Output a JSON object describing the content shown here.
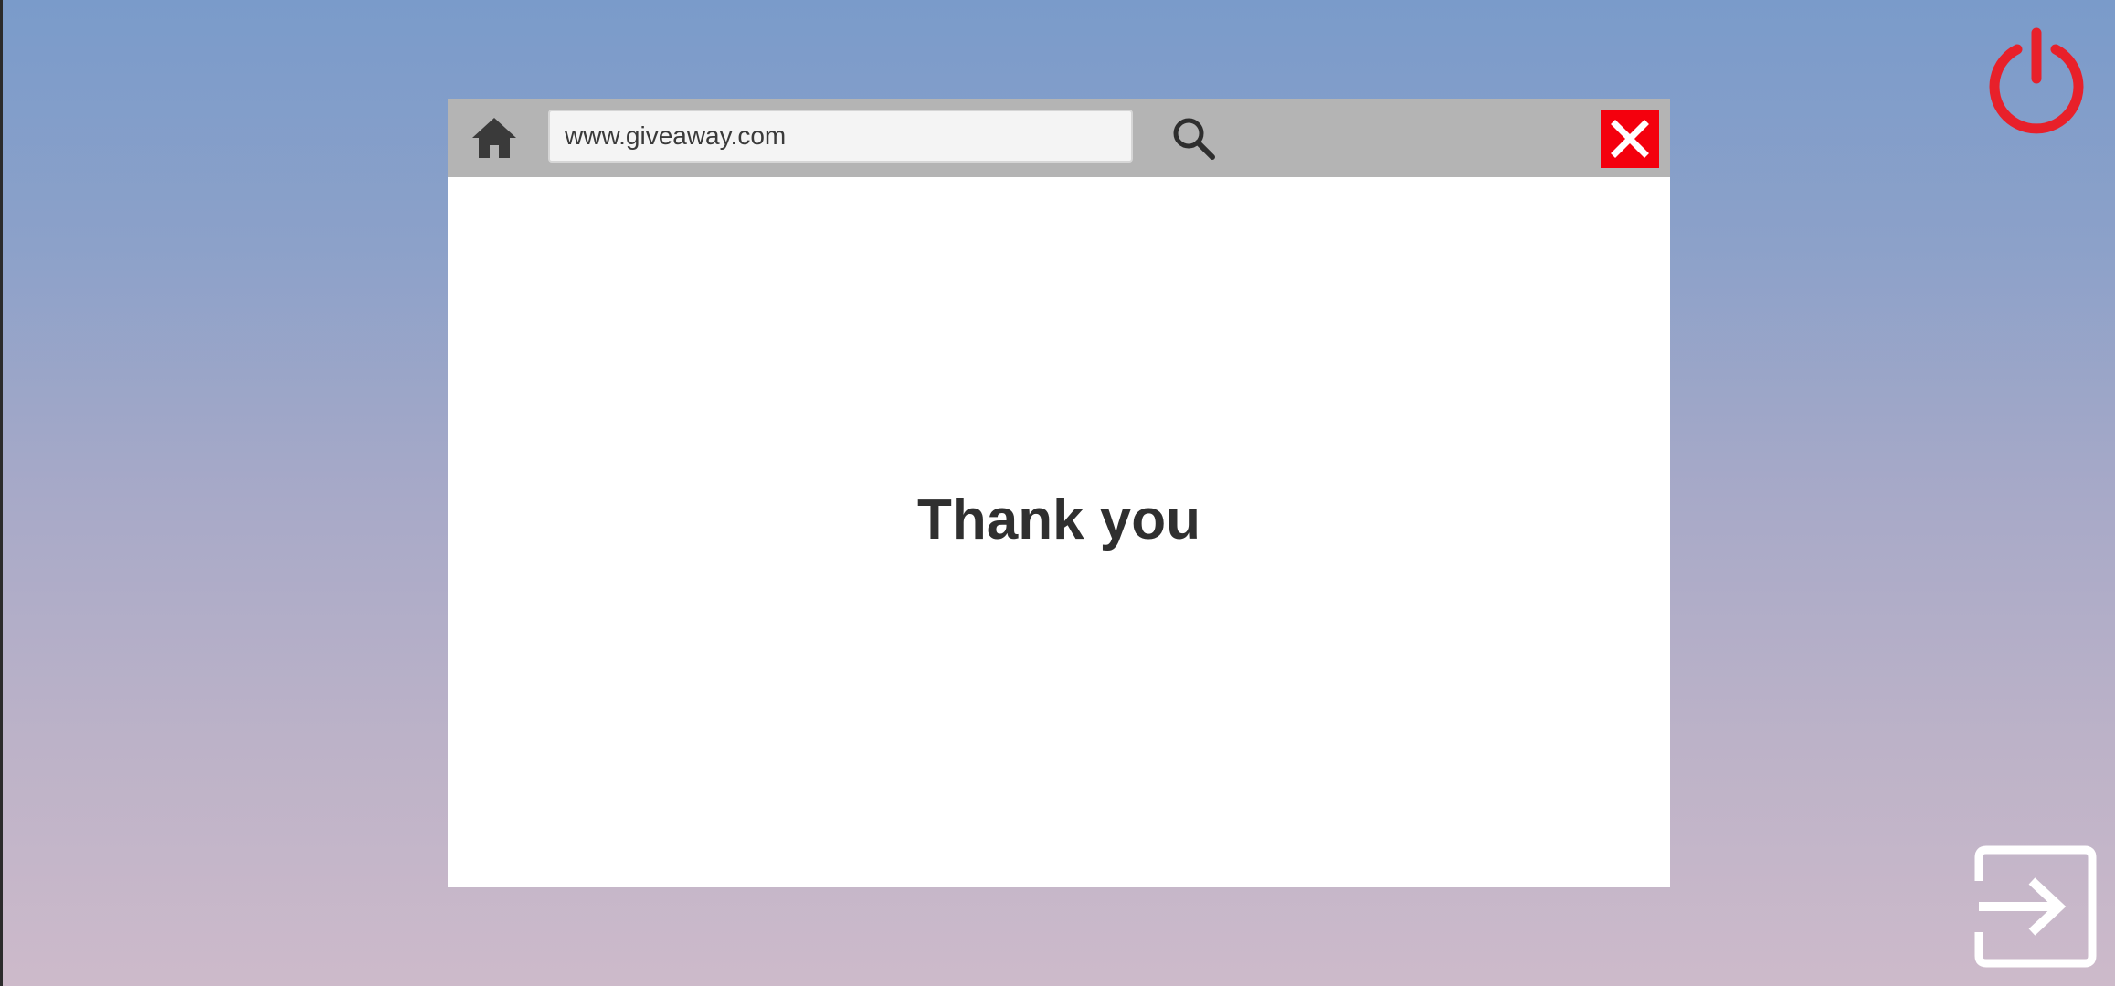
{
  "browser": {
    "url": "www.giveaway.com",
    "message": "Thank you"
  },
  "icons": {
    "home": "home-icon",
    "search": "search-icon",
    "close": "close-icon",
    "power": "power-icon",
    "exit": "exit-icon"
  },
  "colors": {
    "close_button": "#f4000d",
    "power_icon": "#e8202a",
    "toolbar": "#b4b4b4",
    "background_top": "#7a9bca",
    "background_bottom": "#cdbaca"
  }
}
